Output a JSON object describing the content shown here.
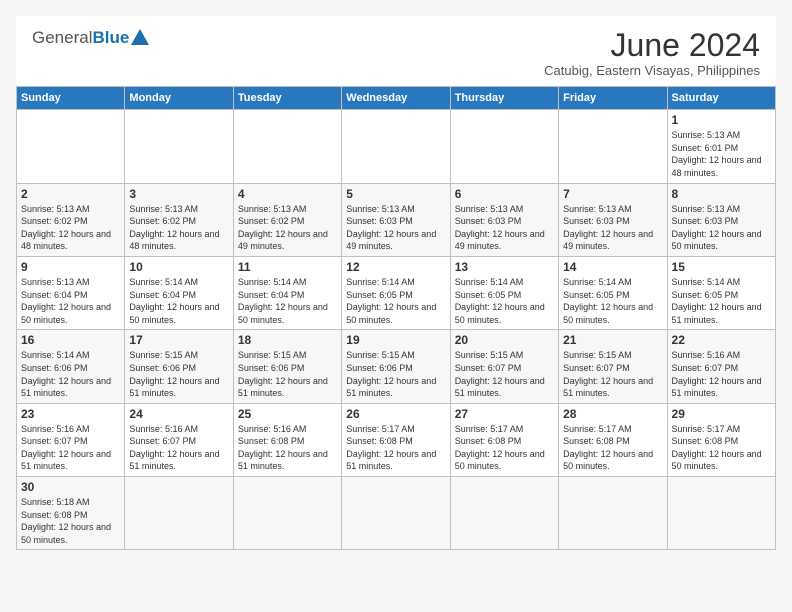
{
  "header": {
    "logo_general": "General",
    "logo_blue": "Blue",
    "month_title": "June 2024",
    "location": "Catubig, Eastern Visayas, Philippines"
  },
  "weekdays": [
    "Sunday",
    "Monday",
    "Tuesday",
    "Wednesday",
    "Thursday",
    "Friday",
    "Saturday"
  ],
  "weeks": [
    [
      {
        "day": "",
        "info": ""
      },
      {
        "day": "",
        "info": ""
      },
      {
        "day": "",
        "info": ""
      },
      {
        "day": "",
        "info": ""
      },
      {
        "day": "",
        "info": ""
      },
      {
        "day": "",
        "info": ""
      },
      {
        "day": "1",
        "info": "Sunrise: 5:13 AM\nSunset: 6:01 PM\nDaylight: 12 hours and 48 minutes."
      }
    ],
    [
      {
        "day": "2",
        "info": "Sunrise: 5:13 AM\nSunset: 6:02 PM\nDaylight: 12 hours and 48 minutes."
      },
      {
        "day": "3",
        "info": "Sunrise: 5:13 AM\nSunset: 6:02 PM\nDaylight: 12 hours and 48 minutes."
      },
      {
        "day": "4",
        "info": "Sunrise: 5:13 AM\nSunset: 6:02 PM\nDaylight: 12 hours and 49 minutes."
      },
      {
        "day": "5",
        "info": "Sunrise: 5:13 AM\nSunset: 6:03 PM\nDaylight: 12 hours and 49 minutes."
      },
      {
        "day": "6",
        "info": "Sunrise: 5:13 AM\nSunset: 6:03 PM\nDaylight: 12 hours and 49 minutes."
      },
      {
        "day": "7",
        "info": "Sunrise: 5:13 AM\nSunset: 6:03 PM\nDaylight: 12 hours and 49 minutes."
      },
      {
        "day": "8",
        "info": "Sunrise: 5:13 AM\nSunset: 6:03 PM\nDaylight: 12 hours and 50 minutes."
      }
    ],
    [
      {
        "day": "9",
        "info": "Sunrise: 5:13 AM\nSunset: 6:04 PM\nDaylight: 12 hours and 50 minutes."
      },
      {
        "day": "10",
        "info": "Sunrise: 5:14 AM\nSunset: 6:04 PM\nDaylight: 12 hours and 50 minutes."
      },
      {
        "day": "11",
        "info": "Sunrise: 5:14 AM\nSunset: 6:04 PM\nDaylight: 12 hours and 50 minutes."
      },
      {
        "day": "12",
        "info": "Sunrise: 5:14 AM\nSunset: 6:05 PM\nDaylight: 12 hours and 50 minutes."
      },
      {
        "day": "13",
        "info": "Sunrise: 5:14 AM\nSunset: 6:05 PM\nDaylight: 12 hours and 50 minutes."
      },
      {
        "day": "14",
        "info": "Sunrise: 5:14 AM\nSunset: 6:05 PM\nDaylight: 12 hours and 50 minutes."
      },
      {
        "day": "15",
        "info": "Sunrise: 5:14 AM\nSunset: 6:05 PM\nDaylight: 12 hours and 51 minutes."
      }
    ],
    [
      {
        "day": "16",
        "info": "Sunrise: 5:14 AM\nSunset: 6:06 PM\nDaylight: 12 hours and 51 minutes."
      },
      {
        "day": "17",
        "info": "Sunrise: 5:15 AM\nSunset: 6:06 PM\nDaylight: 12 hours and 51 minutes."
      },
      {
        "day": "18",
        "info": "Sunrise: 5:15 AM\nSunset: 6:06 PM\nDaylight: 12 hours and 51 minutes."
      },
      {
        "day": "19",
        "info": "Sunrise: 5:15 AM\nSunset: 6:06 PM\nDaylight: 12 hours and 51 minutes."
      },
      {
        "day": "20",
        "info": "Sunrise: 5:15 AM\nSunset: 6:07 PM\nDaylight: 12 hours and 51 minutes."
      },
      {
        "day": "21",
        "info": "Sunrise: 5:15 AM\nSunset: 6:07 PM\nDaylight: 12 hours and 51 minutes."
      },
      {
        "day": "22",
        "info": "Sunrise: 5:16 AM\nSunset: 6:07 PM\nDaylight: 12 hours and 51 minutes."
      }
    ],
    [
      {
        "day": "23",
        "info": "Sunrise: 5:16 AM\nSunset: 6:07 PM\nDaylight: 12 hours and 51 minutes."
      },
      {
        "day": "24",
        "info": "Sunrise: 5:16 AM\nSunset: 6:07 PM\nDaylight: 12 hours and 51 minutes."
      },
      {
        "day": "25",
        "info": "Sunrise: 5:16 AM\nSunset: 6:08 PM\nDaylight: 12 hours and 51 minutes."
      },
      {
        "day": "26",
        "info": "Sunrise: 5:17 AM\nSunset: 6:08 PM\nDaylight: 12 hours and 51 minutes."
      },
      {
        "day": "27",
        "info": "Sunrise: 5:17 AM\nSunset: 6:08 PM\nDaylight: 12 hours and 50 minutes."
      },
      {
        "day": "28",
        "info": "Sunrise: 5:17 AM\nSunset: 6:08 PM\nDaylight: 12 hours and 50 minutes."
      },
      {
        "day": "29",
        "info": "Sunrise: 5:17 AM\nSunset: 6:08 PM\nDaylight: 12 hours and 50 minutes."
      }
    ],
    [
      {
        "day": "30",
        "info": "Sunrise: 5:18 AM\nSunset: 6:08 PM\nDaylight: 12 hours and 50 minutes."
      },
      {
        "day": "",
        "info": ""
      },
      {
        "day": "",
        "info": ""
      },
      {
        "day": "",
        "info": ""
      },
      {
        "day": "",
        "info": ""
      },
      {
        "day": "",
        "info": ""
      },
      {
        "day": "",
        "info": ""
      }
    ]
  ]
}
